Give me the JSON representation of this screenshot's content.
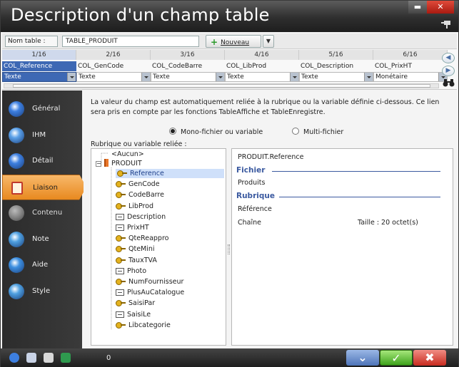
{
  "window": {
    "title": "Description d'un champ table",
    "minimize_label": "▬",
    "close_label": "✕"
  },
  "toolbar": {
    "table_label": "Nom table :",
    "table_value": "TABLE_PRODUIT",
    "new_plus": "+",
    "new_label": "Nouveau",
    "new_arrow": "▼"
  },
  "columns": [
    {
      "index": "1/16",
      "name": "COL_Reference",
      "type": "Texte",
      "selected": true
    },
    {
      "index": "2/16",
      "name": "COL_GenCode",
      "type": "Texte",
      "selected": false
    },
    {
      "index": "3/16",
      "name": "COL_CodeBarre",
      "type": "Texte",
      "selected": false
    },
    {
      "index": "4/16",
      "name": "COL_LibProd",
      "type": "Texte",
      "selected": false
    },
    {
      "index": "5/16",
      "name": "COL_Description",
      "type": "Texte",
      "selected": false
    },
    {
      "index": "6/16",
      "name": "COL_PrixHT",
      "type": "Monétaire",
      "selected": false
    }
  ],
  "sidebar": {
    "items": [
      {
        "label": "Général",
        "icon": "circle-icon",
        "color": "#3d7fe0"
      },
      {
        "label": "IHM",
        "icon": "glasses-icon",
        "color": "#5aa0e8"
      },
      {
        "label": "Détail",
        "icon": "circle-icon",
        "color": "#3d7fe0"
      },
      {
        "label": "Liaison",
        "icon": "link-icon",
        "color": "#e8891f"
      },
      {
        "label": "Contenu",
        "icon": "hand-icon",
        "color": "#777777"
      },
      {
        "label": "Note",
        "icon": "pencil-icon",
        "color": "#4fa0e0"
      },
      {
        "label": "Aide",
        "icon": "help-icon",
        "color": "#3d8fe0"
      },
      {
        "label": "Style",
        "icon": "brush-icon",
        "color": "#4fa0e0"
      }
    ]
  },
  "main": {
    "description": "La valeur du champ est automatiquement reliée à la rubrique ou la variable définie ci-dessous. Ce lien sera pris en compte par les fonctions TableAffiche et TableEnregistre.",
    "radio_mono": "Mono-fichier ou variable",
    "radio_multi": "Multi-fichier",
    "rubrique_label": "Rubrique ou variable reliée :"
  },
  "tree": {
    "aucun": "<Aucun>",
    "root": "PRODUIT",
    "items": [
      {
        "label": "Reference",
        "icon": "key-icon",
        "selected": true
      },
      {
        "label": "GenCode",
        "icon": "key-icon"
      },
      {
        "label": "CodeBarre",
        "icon": "key-icon"
      },
      {
        "label": "LibProd",
        "icon": "key-icon"
      },
      {
        "label": "Description",
        "icon": "field-icon"
      },
      {
        "label": "PrixHT",
        "icon": "field-icon"
      },
      {
        "label": "QteReappro",
        "icon": "key-icon"
      },
      {
        "label": "QteMini",
        "icon": "key-icon"
      },
      {
        "label": "TauxTVA",
        "icon": "key-icon"
      },
      {
        "label": "Photo",
        "icon": "field-icon"
      },
      {
        "label": "NumFournisseur",
        "icon": "key-icon"
      },
      {
        "label": "PlusAuCatalogue",
        "icon": "field-icon"
      },
      {
        "label": "SaisiPar",
        "icon": "key-icon"
      },
      {
        "label": "SaisiLe",
        "icon": "field-icon"
      },
      {
        "label": "Libcategorie",
        "icon": "key-icon"
      }
    ]
  },
  "info": {
    "path": "PRODUIT.Reference",
    "fichier_head": "Fichier",
    "fichier_value": "Produits",
    "rubrique_head": "Rubrique",
    "rubrique_value": "Référence",
    "type_value": "Chaîne",
    "size_value": "Taille : 20 octet(s)"
  },
  "bottom": {
    "count": "0",
    "ok_label": "✓",
    "cancel_label": "✖",
    "down_label": "⌄"
  }
}
